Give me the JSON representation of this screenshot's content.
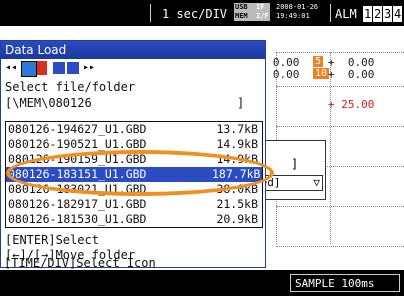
{
  "status_bar": {
    "timebase": "1 sec/DIV",
    "usb_top": "USB",
    "usb_mem": "MEM",
    "usb_if_top": "IF",
    "usb_if": "I/F",
    "date": "2008-01-26",
    "time": "19:49:01",
    "alm": "ALM",
    "channels": [
      "1",
      "2",
      "3",
      "4"
    ]
  },
  "readouts": {
    "r1": "+  0.00",
    "r2": "+  0.00",
    "badge1": "5",
    "badge2": "10",
    "r1b": "+  0.00",
    "r2b": "+  0.00",
    "scale": "+ 25.00"
  },
  "dialog": {
    "title": "Data Load",
    "prompt": "Select file/folder",
    "path": "[\\MEM\\080126",
    "path_end": "]",
    "files": [
      {
        "name": "080126-194627_U1.GBD",
        "size": "13.7kB"
      },
      {
        "name": "080126-190521_U1.GBD",
        "size": "14.9kB"
      },
      {
        "name": "080126-190159_U1.GBD",
        "size": "14.9kB"
      },
      {
        "name": "080126-183151_U1.GBD",
        "size": "187.7kB"
      },
      {
        "name": "080126-183021_U1.GBD",
        "size": "38.0kB"
      },
      {
        "name": "080126-182917_U1.GBD",
        "size": "21.5kB"
      },
      {
        "name": "080126-181530_U1.GBD",
        "size": "20.9kB"
      }
    ],
    "help1": "[ENTER]Select",
    "help2": "[←]/[→]Move folder",
    "help3": "[TIME/DIV]Select Icon"
  },
  "background": {
    "bracket": "]",
    "select_text": "red]",
    "arrow": "▽"
  },
  "bottom_bar": {
    "sample": "SAMPLE   100ms"
  },
  "colors": {
    "title": "#2b4cc2",
    "selection": "#2b4cc2",
    "highlight_oval": "#f09020",
    "badge1": "#f08020",
    "badge2": "#f08020"
  }
}
